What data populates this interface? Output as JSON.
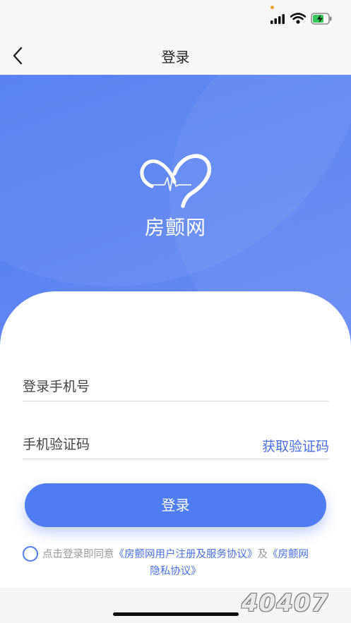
{
  "nav": {
    "title": "登录"
  },
  "hero": {
    "brand_name": "房颤网"
  },
  "form": {
    "phone_placeholder": "登录手机号",
    "code_placeholder": "手机验证码",
    "get_code_label": "获取验证码",
    "login_label": "登录"
  },
  "agreement": {
    "prefix": "点击登录即同意",
    "terms_link": "《房颤网用户注册及服务协议》",
    "and": "及",
    "privacy_link_part1": "《房颤网",
    "privacy_link_part2": "隐私协议》"
  },
  "watermark": "40407",
  "colors": {
    "primary": "#4f7cf0",
    "link": "#4c6ee8"
  }
}
